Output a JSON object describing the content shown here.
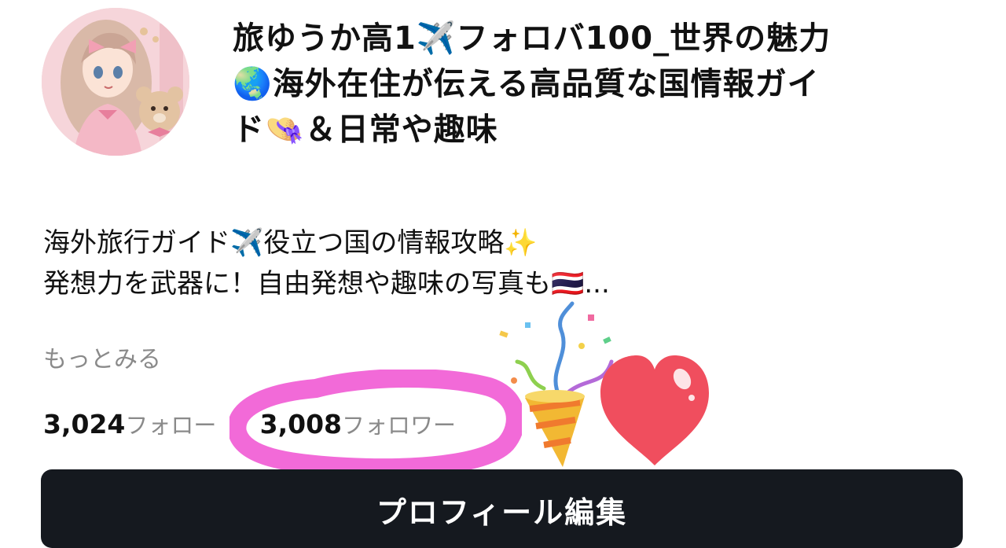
{
  "profile": {
    "avatar_icon": "anime-girl-with-teddy-bear-avatar",
    "name_lines": [
      "旅ゆうか高1✈️フォロバ100_世界の魅力",
      "🌏海外在住が伝える高品質な国情報ガイ",
      "ド👒＆日常や趣味"
    ],
    "bio_lines": [
      "海外旅行ガイド✈️役立つ国の情報攻略✨",
      "発想力を武器に！自由発想や趣味の写真も🇹🇭..."
    ],
    "more_label": "もっとみる"
  },
  "stats": {
    "following": {
      "count": "3,024",
      "label": "フォロー"
    },
    "followers": {
      "count": "3,008",
      "label": "フォロワー"
    }
  },
  "decorations": {
    "highlight_color": "#f26ad8",
    "icons": [
      "party-popper-icon",
      "heart-icon"
    ],
    "heart_color": "#f04e5e"
  },
  "actions": {
    "edit_profile_label": "プロフィール編集"
  }
}
